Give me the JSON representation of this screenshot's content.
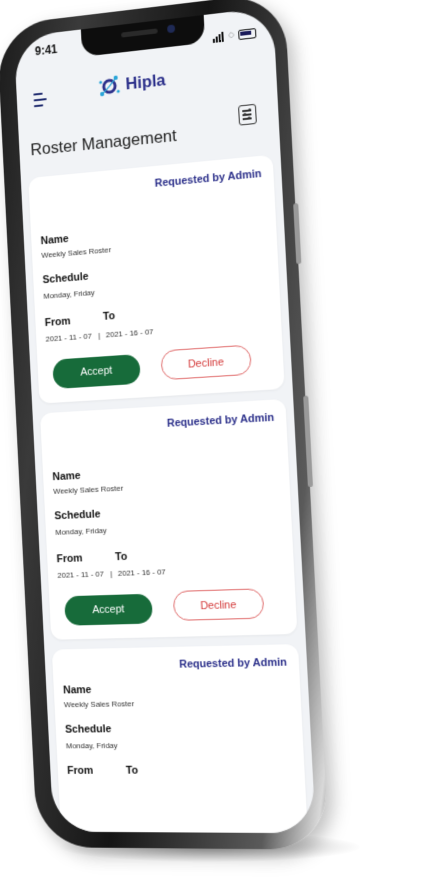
{
  "status_bar": {
    "time": "9:41"
  },
  "header": {
    "brand": "Hipla"
  },
  "page": {
    "title": "Roster Management"
  },
  "rosters": [
    {
      "tag": "Requested by Admin",
      "name_label": "Name",
      "name": "Weekly Sales Roster",
      "schedule_label": "Schedule",
      "schedule": "Monday, Friday",
      "from_label": "From",
      "to_label": "To",
      "from": "2021 - 11 - 07",
      "separator": "|",
      "to": "2021 - 16 - 07",
      "accept": "Accept",
      "decline": "Decline"
    },
    {
      "tag": "Requested by Admin",
      "name_label": "Name",
      "name": "Weekly Sales Roster",
      "schedule_label": "Schedule",
      "schedule": "Monday, Friday",
      "from_label": "From",
      "to_label": "To",
      "from": "2021 - 11 - 07",
      "separator": "|",
      "to": "2021 - 16 - 07",
      "accept": "Accept",
      "decline": "Decline"
    },
    {
      "tag": "Requested by Admin",
      "name_label": "Name",
      "name": "Weekly Sales Roster",
      "schedule_label": "Schedule",
      "schedule": "Monday, Friday",
      "from_label": "From",
      "to_label": "To",
      "from": "",
      "separator": "",
      "to": "",
      "accept": "",
      "decline": ""
    }
  ],
  "colors": {
    "brand": "#2b2f8a",
    "accept": "#176b3a",
    "decline": "#d43a3a",
    "screen_bg": "#f1f3f6"
  },
  "icons": {
    "menu": "menu-icon",
    "filter": "filter-icon",
    "logo": "hipla-logo-icon"
  }
}
